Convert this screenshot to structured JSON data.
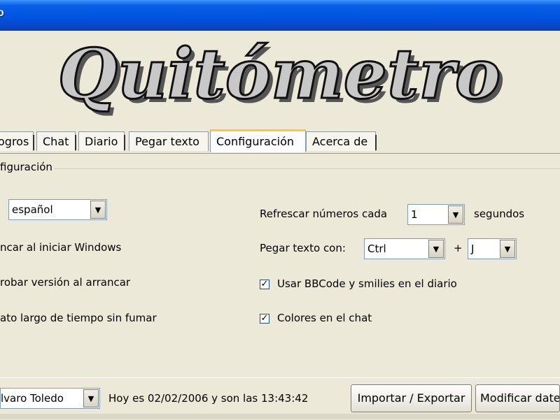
{
  "window": {
    "title": "o"
  },
  "logo": {
    "text": "Quitómetro"
  },
  "tabs": [
    {
      "label": "ogros"
    },
    {
      "label": "Chat"
    },
    {
      "label": "Diario"
    },
    {
      "label": "Pegar texto"
    },
    {
      "label": "Configuración",
      "active": true
    },
    {
      "label": "Acerca de"
    }
  ],
  "config": {
    "group_label": "figuración",
    "language": {
      "value": "español"
    },
    "start_windows_label": "ncar al iniciar Windows",
    "check_version_label": "robar versión al arrancar",
    "long_time_label": "ato largo de tiempo sin fumar",
    "refresh": {
      "label": "Refrescar números cada",
      "value": "1",
      "unit": "segundos"
    },
    "paste": {
      "label": "Pegar texto con:",
      "modifier": "Ctrl",
      "plus": "+",
      "key": "J"
    },
    "bbcode": {
      "label": "Usar BBCode y smilies en el diario",
      "checked": true
    },
    "chat_colors": {
      "label": "Colores en el chat",
      "checked": true
    }
  },
  "status": {
    "user": "lvaro Toledo",
    "date_text": "Hoy es 02/02/2006 y son las 13:43:42",
    "import_export_label": "Importar / Exportar",
    "modify_label": "Modificar date"
  },
  "icons": {
    "dropdown": "chevron-down-icon",
    "check": "checkmark-icon"
  }
}
